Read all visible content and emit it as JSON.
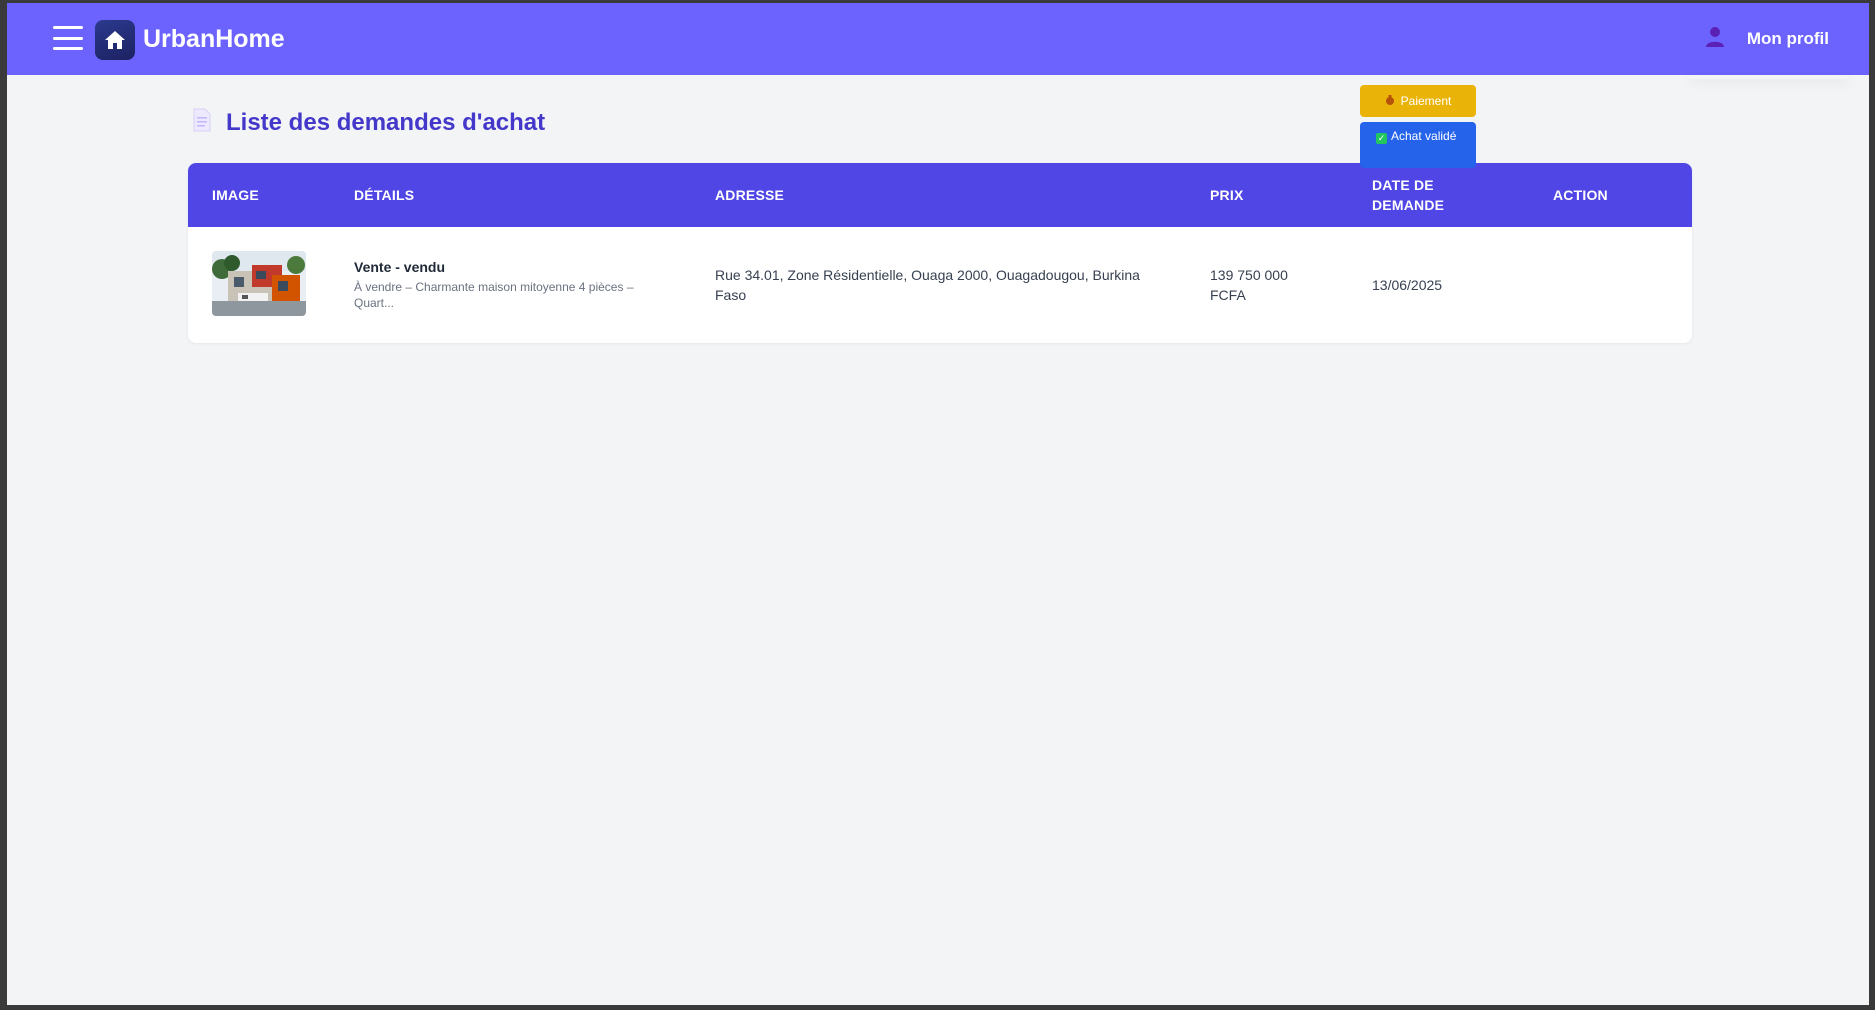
{
  "header": {
    "brand": "UrbanHome",
    "profile_label": "Mon profil"
  },
  "page": {
    "title": "Liste des demandes d'achat"
  },
  "table": {
    "columns": [
      "IMAGE",
      "DÉTAILS",
      "ADRESSE",
      "PRIX",
      "DATE DE DEMANDE",
      "ACTION"
    ],
    "rows": [
      {
        "title": "Vente - vendu",
        "description": "À vendre – Charmante maison mitoyenne 4 pièces – Quart...",
        "address": "Rue 34.01, Zone Résidentielle, Ouaga 2000, Ouagadougou, Burkina Faso",
        "price": "139 750 000 FCFA",
        "date": "13/06/2025",
        "pay_label": "Paiement",
        "validated_label": "Achat validé"
      }
    ]
  },
  "colors": {
    "topbar": "#6c63ff",
    "table_header": "#4f46e5",
    "title": "#4338ca",
    "pay_button": "#eab308",
    "validated_button": "#2563eb"
  }
}
